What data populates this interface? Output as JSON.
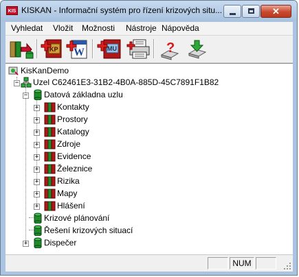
{
  "window": {
    "title": "KISKAN - Informační systém pro řízení krizových situ...",
    "icon_text": "KIS"
  },
  "menu": [
    "Vyhledat",
    "Vložit",
    "Možnosti",
    "Nástroje",
    "Nápověda"
  ],
  "toolbar": {
    "buttons": [
      {
        "icon": "export-db-icon"
      },
      {
        "icon": "kp-book-icon"
      },
      {
        "icon": "word-icon"
      },
      {
        "icon": "mu-book-icon"
      },
      {
        "icon": "printer-icon"
      },
      {
        "icon": "help-icon"
      },
      {
        "icon": "download-icon"
      }
    ]
  },
  "tree": {
    "root": "KisKanDemo",
    "node": "Uzel C62461E3-31B2-4B0A-885D-45C7891F1B82",
    "datova": "Datová základna uzlu",
    "children": [
      "Kontakty",
      "Prostory",
      "Katalogy",
      "Zdroje",
      "Evidence",
      "Železnice",
      "Rizika",
      "Mapy",
      "Hlášení"
    ],
    "krizove": "Krizové plánování",
    "reseni": "Řešení krizových situací",
    "dispecer": "Dispečer"
  },
  "status": {
    "num": "NUM"
  },
  "colors": {
    "db_green": "#1f8b2a",
    "book_red": "#b01818",
    "title_bar": "#b4cce6"
  }
}
